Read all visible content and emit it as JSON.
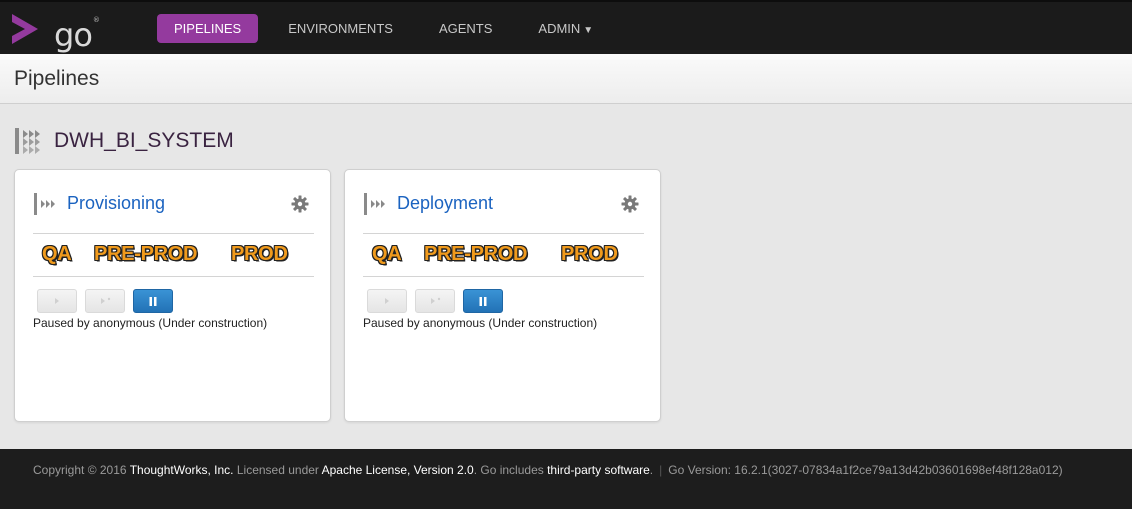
{
  "header": {
    "logo_text": "go",
    "logo_mark": "®",
    "nav": [
      {
        "label": "PIPELINES",
        "active": true
      },
      {
        "label": "ENVIRONMENTS",
        "active": false
      },
      {
        "label": "AGENTS",
        "active": false
      },
      {
        "label": "ADMIN",
        "active": false,
        "dropdown": true
      }
    ],
    "caret": "▼"
  },
  "page": {
    "title": "Pipelines"
  },
  "group": {
    "name": "DWH_BI_SYSTEM",
    "icon": "pipeline-group-icon"
  },
  "pipelines": [
    {
      "name": "Provisioning",
      "stages": [
        "QA",
        "PRE-PROD",
        "PROD"
      ],
      "status": "Paused by anonymous (Under construction)"
    },
    {
      "name": "Deployment",
      "stages": [
        "QA",
        "PRE-PROD",
        "PROD"
      ],
      "status": "Paused by anonymous (Under construction)"
    }
  ],
  "footer": {
    "copyright": "Copyright © 2016",
    "company": "ThoughtWorks, Inc.",
    "licensed": "Licensed under",
    "license": "Apache License, Version 2.0",
    "includes": ". Go includes",
    "third_party": "third-party software",
    "period": ".",
    "separator": "|",
    "version": "Go Version: 16.2.1(3027-07834a1f2ce79a13d42b03601698ef48f128a012)"
  },
  "colors": {
    "accent": "#943a9e",
    "link": "#1b63c0",
    "stage": "#f09a1c",
    "pause_button": "#2a7fc4"
  }
}
